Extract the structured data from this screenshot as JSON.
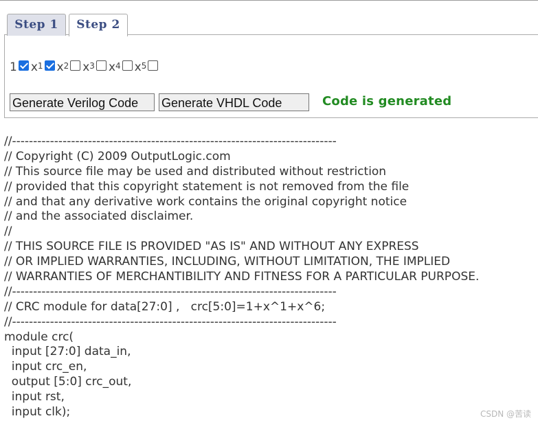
{
  "tabs": [
    {
      "label": "Step 1",
      "active": false
    },
    {
      "label": "Step 2",
      "active": true
    }
  ],
  "polynomial": {
    "terms": [
      {
        "base": "1",
        "exp": "",
        "checked": true
      },
      {
        "base": "x",
        "exp": "1",
        "checked": true
      },
      {
        "base": "x",
        "exp": "2",
        "checked": false
      },
      {
        "base": "x",
        "exp": "3",
        "checked": false
      },
      {
        "base": "x",
        "exp": "4",
        "checked": false
      },
      {
        "base": "x",
        "exp": "5",
        "checked": false
      }
    ]
  },
  "buttons": {
    "verilog_label": "Generate Verilog Code",
    "vhdl_label": "Generate VHDL Code"
  },
  "status": {
    "text": "Code is generated",
    "color": "#228b22"
  },
  "code_lines": [
    "//-----------------------------------------------------------------------------",
    "// Copyright (C) 2009 OutputLogic.com",
    "// This source file may be used and distributed without restriction",
    "// provided that this copyright statement is not removed from the file",
    "// and that any derivative work contains the original copyright notice",
    "// and the associated disclaimer.",
    "//",
    "// THIS SOURCE FILE IS PROVIDED \"AS IS\" AND WITHOUT ANY EXPRESS",
    "// OR IMPLIED WARRANTIES, INCLUDING, WITHOUT LIMITATION, THE IMPLIED",
    "// WARRANTIES OF MERCHANTIBILITY AND FITNESS FOR A PARTICULAR PURPOSE.",
    "//-----------------------------------------------------------------------------",
    "// CRC module for data[27:0] ,   crc[5:0]=1+x^1+x^6;",
    "//-----------------------------------------------------------------------------",
    "module crc(",
    "  input [27:0] data_in,",
    "  input crc_en,",
    "  output [5:0] crc_out,",
    "  input rst,",
    "  input clk);"
  ],
  "watermark": "CSDN @苦读"
}
